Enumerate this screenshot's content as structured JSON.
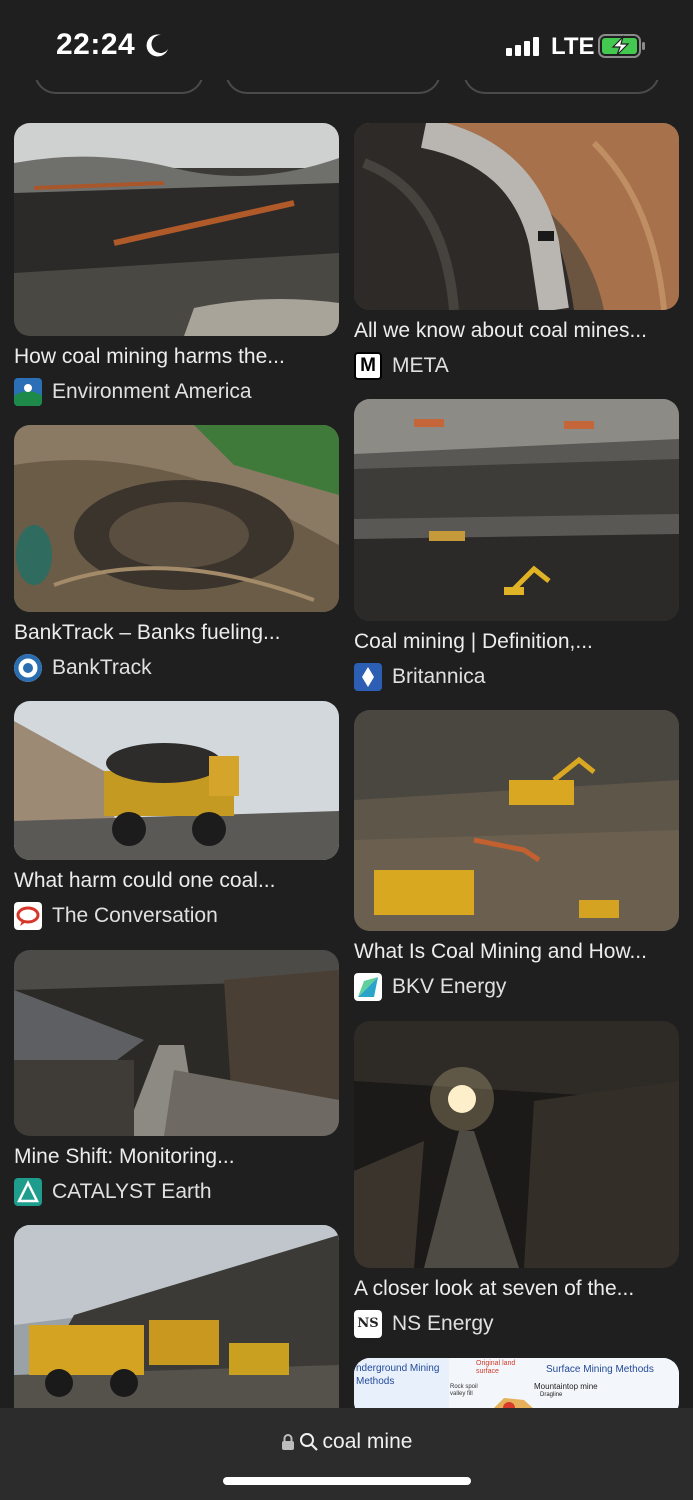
{
  "status": {
    "time": "22:24",
    "network": "LTE"
  },
  "results": [
    {
      "caption": "How coal mining harms the...",
      "source": "Environment America",
      "favicon": "environment-america-icon"
    },
    {
      "caption": "All we know about coal mines...",
      "source": "META",
      "favicon": "meta-m-icon"
    },
    {
      "caption": "BankTrack – Banks fueling...",
      "source": "BankTrack",
      "favicon": "banktrack-icon"
    },
    {
      "caption": "Coal mining | Definition,...",
      "source": "Britannica",
      "favicon": "britannica-icon"
    },
    {
      "caption": "What harm could one coal...",
      "source": "The Conversation",
      "favicon": "conversation-icon"
    },
    {
      "caption": "What Is Coal Mining and How...",
      "source": "BKV Energy",
      "favicon": "bkv-icon"
    },
    {
      "caption": "Mine Shift: Monitoring...",
      "source": "CATALYST Earth",
      "favicon": "catalyst-icon"
    },
    {
      "caption": "A closer look at seven of the...",
      "source": "NS Energy",
      "favicon": "ns-energy-icon"
    },
    {
      "caption": "",
      "source": "",
      "favicon": ""
    }
  ],
  "partial_image_text": {
    "left": "nderground Mining Methods",
    "original": "Original land surface",
    "right": "Surface Mining Methods",
    "mountaintop": "Mountaintop mine",
    "dragline": "Dragline",
    "rock": "Rock spoil valley fill"
  },
  "favicon_text": {
    "meta": "M",
    "ns": "NS"
  },
  "address_bar": {
    "query": "coal mine",
    "lock_icon": "lock-icon",
    "search_icon": "search-icon"
  }
}
